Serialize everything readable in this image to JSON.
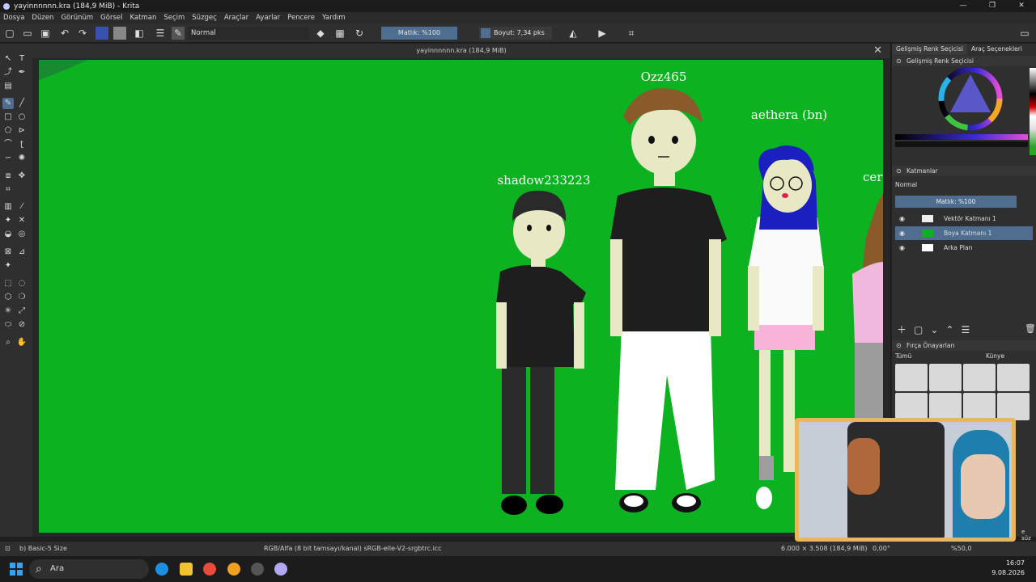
{
  "window": {
    "title": "yayinnnnnn.kra (184,9 MiB) - Krita",
    "controls": [
      "—",
      "❐",
      "✕"
    ]
  },
  "menu": [
    "Dosya",
    "Düzen",
    "Görünüm",
    "Görsel",
    "Katman",
    "Seçim",
    "Süzgeç",
    "Araçlar",
    "Ayarlar",
    "Pencere",
    "Yardım"
  ],
  "toolbar": {
    "blend_mode": "Normal",
    "opacity": "Matlık: %100",
    "size": "Boyut: 7,34 pks"
  },
  "document": {
    "title": "yayinnnnnn.kra (184,9 MiB)"
  },
  "canvas": {
    "labels": [
      "Ozz465",
      "aethera (bn)",
      "shadow233223",
      "cer"
    ],
    "background_color": "#0cb220"
  },
  "right_panel": {
    "tabs": [
      "Gelişmiş Renk Seçicisi",
      "Araç Seçenekleri"
    ],
    "color_header": "Gelişmiş Renk Seçicisi",
    "layers_header": "Katmanlar",
    "layers_blend": "Normal",
    "layers_opacity": "Matlık: %100",
    "layers": [
      {
        "name": "Vektör Katmanı 1"
      },
      {
        "name": "Boya Katmanı 1",
        "selected": true
      },
      {
        "name": "Arka Plan"
      }
    ],
    "brush_header": "Fırça Önayarları",
    "brush_filter": "Tümü",
    "brush_tag": "Künye"
  },
  "status": {
    "brush": "b) Basic-5 Size",
    "color_space": "RGB/Alfa (8 bit tamsayı/kanal) sRGB-elle-V2-srgbtrc.icc",
    "dims": "6.000 × 3.508 (184,9 MiB)",
    "rotation": "0,00°",
    "zoom": "%50,0",
    "filter_hint": "e süz"
  },
  "taskbar": {
    "search": "Ara",
    "time": "16:07",
    "date": "9.08.2026"
  }
}
